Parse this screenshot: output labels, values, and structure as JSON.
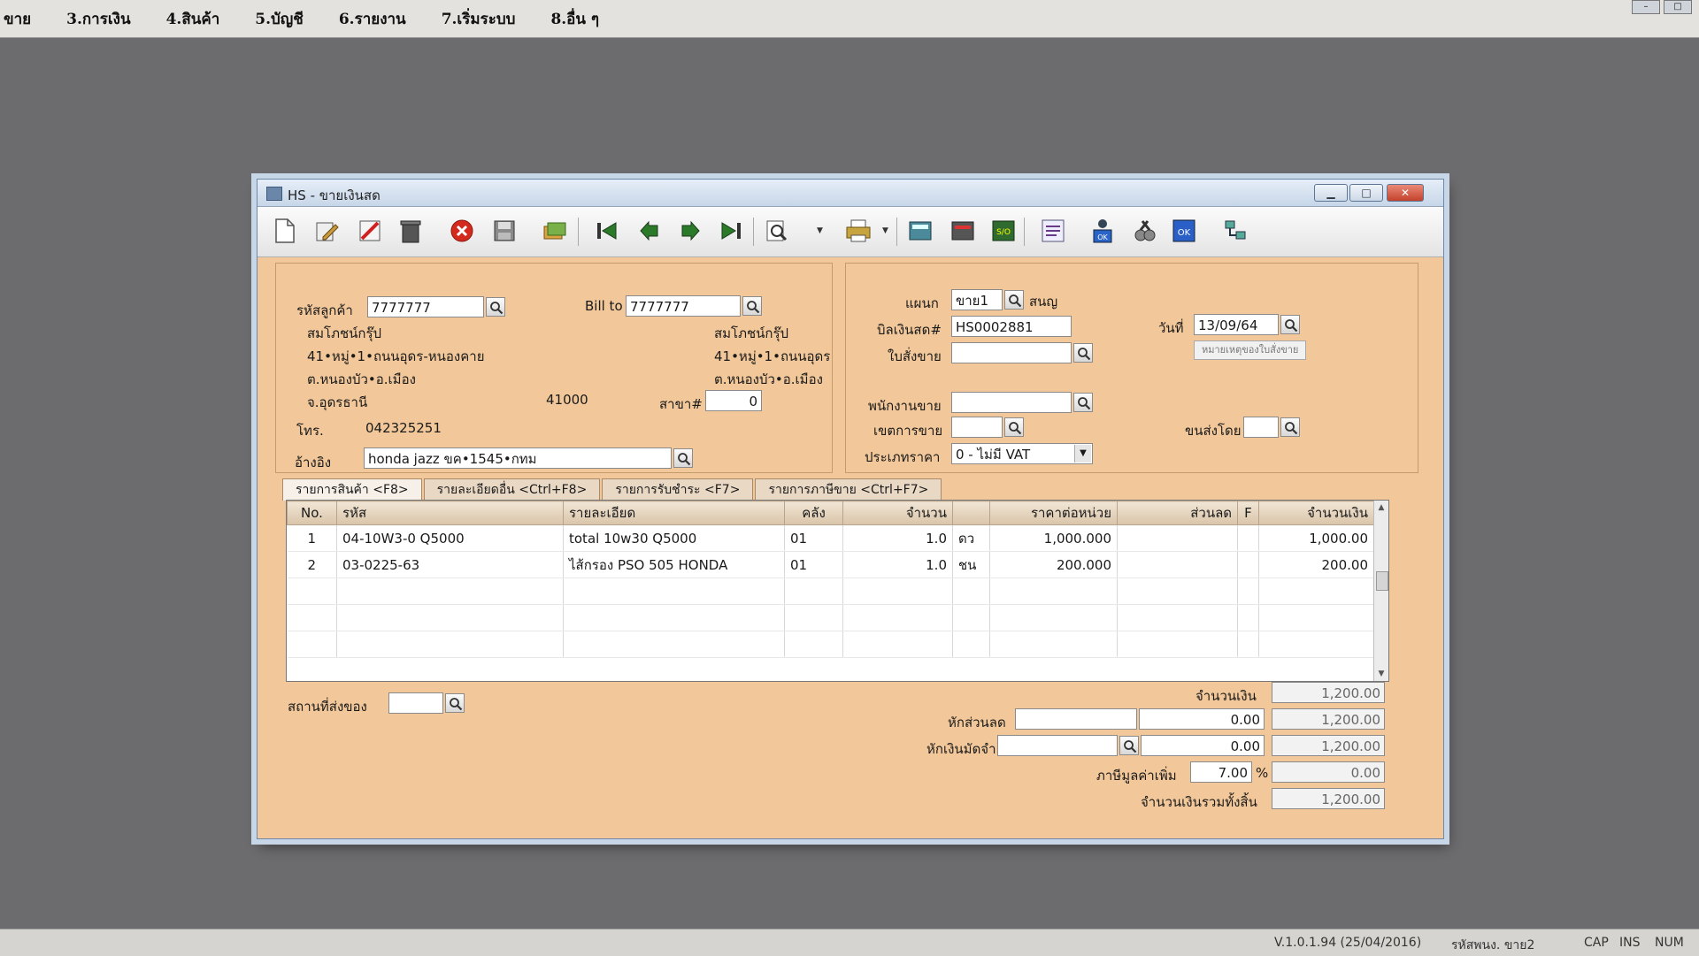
{
  "menu": [
    "ขาย",
    "3.การเงิน",
    "4.สินค้า",
    "5.บัญชี",
    "6.รายงาน",
    "7.เริ่มระบบ",
    "8.อื่น ๆ"
  ],
  "window": {
    "title": "HS - ขายเงินสด"
  },
  "toolbar": {
    "icons": [
      "new-document-icon",
      "edit-icon",
      "cancel-doc-icon",
      "delete-bin-icon",
      "close-red-icon",
      "save-disk-icon",
      "copy-stack-icon",
      "first-record-icon",
      "previous-record-icon",
      "next-record-icon",
      "last-record-icon",
      "search-preview-icon",
      "printer-icon",
      "calculator-icon",
      "cash-register-icon",
      "sales-order-icon",
      "receipt-icon",
      "user-ok-icon",
      "tools-icon",
      "approve-ok-icon",
      "network-icon"
    ]
  },
  "customer": {
    "code_label": "รหัสลูกค้า",
    "code": "7777777",
    "name": "สมโภชน์กรุ๊ป",
    "address1": "41•หมู่•1•ถนนอุดร-หนองคาย",
    "address2": "ต.หนองบัว•อ.เมือง",
    "address3": "จ.อุดรธานี",
    "postcode": "41000",
    "phone_label": "โทร.",
    "phone": "042325251",
    "ref_label": "อ้างอิง",
    "ref": "honda jazz ขค•1545•กทม"
  },
  "billto": {
    "label": "Bill to",
    "code": "7777777",
    "name": "สมโภชน์กรุ๊ป",
    "address1": "41•หมู่•1•ถนนอุดร",
    "address2": "ต.หนองบัว•อ.เมือง",
    "branch_label": "สาขา#",
    "branch": "0"
  },
  "doc": {
    "dept_label": "แผนก",
    "dept": "ขาย1",
    "dept_name": "สนญ",
    "bill_label": "บิลเงินสด#",
    "bill_no": "HS0002881",
    "date_label": "วันที่",
    "date": "13/09/64",
    "so_label": "ใบสั่งขาย",
    "so": "",
    "remark_button": "หมายเหตุของใบสั่งขาย",
    "salesman_label": "พนักงานขาย",
    "salesman": "",
    "area_label": "เขตการขาย",
    "area": "",
    "ship_by_label": "ขนส่งโดย",
    "ship_by": "",
    "price_type_label": "ประเภทราคา",
    "price_type": "0 - ไม่มี VAT"
  },
  "tabs": [
    "รายการสินค้า <F8>",
    "รายละเอียดอื่น <Ctrl+F8>",
    "รายการรับชำระ <F7>",
    "รายการภาษีขาย <Ctrl+F7>"
  ],
  "grid": {
    "columns": [
      "No.",
      "รหัส",
      "รายละเอียด",
      "คลัง",
      "จำนวน",
      "",
      "ราคาต่อหน่วย",
      "ส่วนลด",
      "F",
      "จำนวนเงิน"
    ],
    "rows": [
      [
        "1",
        "04-10W3-0 Q5000",
        "total 10w30 Q5000",
        "01",
        "1.0",
        "ดว",
        "1,000.000",
        "",
        "",
        "1,000.00"
      ],
      [
        "2",
        "03-0225-63",
        "ไส้กรอง PSO 505 HONDA",
        "01",
        "1.0",
        "ชน",
        "200.000",
        "",
        "",
        "200.00"
      ]
    ]
  },
  "footer": {
    "ship_place_label": "สถานที่ส่งของ",
    "ship_place": "",
    "amount_label": "จำนวนเงิน",
    "amount": "1,200.00",
    "discount_label": "หักส่วนลด",
    "discount_text": "",
    "discount": "0.00",
    "after_discount": "1,200.00",
    "deposit_label": "หักเงินมัดจำ",
    "deposit_text": "",
    "deposit": "0.00",
    "after_deposit": "1,200.00",
    "vat_label": "ภาษีมูลค่าเพิ่ม",
    "vat_rate": "7.00",
    "vat_unit": "%",
    "vat_amount": "0.00",
    "total_label": "จำนวนเงินรวมทั้งสิ้น",
    "total": "1,200.00"
  },
  "status": {
    "version": "V.1.0.1.94 (25/04/2016)",
    "user": "รหัสพนง. ขาย2",
    "cap": "CAP",
    "ins": "INS",
    "num": "NUM"
  }
}
